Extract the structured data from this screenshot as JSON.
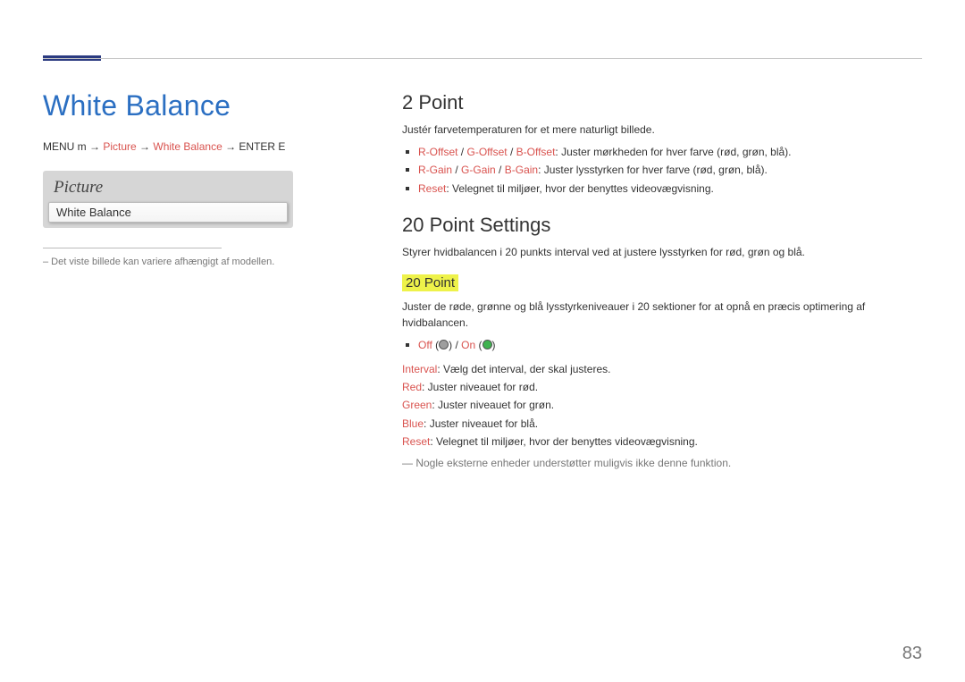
{
  "page_number": "83",
  "left": {
    "h1": "White Balance",
    "menu_path": {
      "prefix": "MENU m → ",
      "picture": "Picture",
      "arrow1": " → ",
      "wb": "White Balance",
      "arrow2": " → ",
      "enter": "ENTER E"
    },
    "picture_box": {
      "title": "Picture",
      "row": "White Balance"
    },
    "small_note": "–  Det viste billede kan variere afhængigt af modellen."
  },
  "right": {
    "s1": {
      "h2": "2 Point",
      "intro": "Justér farvetemperaturen for et mere naturligt billede.",
      "bullets": [
        {
          "r": "R-Offset",
          "sep1": " / ",
          "g": "G-Offset",
          "sep2": " / ",
          "b": "B-Offset",
          "tail": ": Juster mørkheden for hver farve (rød, grøn, blå)."
        },
        {
          "r": "R-Gain",
          "sep1": " / ",
          "g": "G-Gain",
          "sep2": " / ",
          "b": "B-Gain",
          "tail": ": Juster lysstyrken for hver farve (rød, grøn, blå)."
        },
        {
          "r": "Reset",
          "tail": ": Velegnet til miljøer, hvor der benyttes videovægvisning."
        }
      ]
    },
    "s2": {
      "h2": "20 Point Settings",
      "intro": "Styrer hvidbalancen i 20 punkts interval ved at justere lysstyrken for rød, grøn og blå.",
      "h3": "20 Point",
      "desc": "Juster de røde, grønne og blå lysstyrkeniveauer i 20 sektioner for at opnå en præcis optimering af hvidbalancen.",
      "offon": {
        "off": "Off",
        "on": "On"
      },
      "lines": [
        {
          "label": "Interval",
          "text": ": Vælg det interval, der skal justeres."
        },
        {
          "label": "Red",
          "text": ": Juster niveauet for rød."
        },
        {
          "label": "Green",
          "text": ": Juster niveauet for grøn."
        },
        {
          "label": "Blue",
          "text": ": Juster niveauet for blå."
        },
        {
          "label": "Reset",
          "text": ": Velegnet til miljøer, hvor der benyttes videovægvisning."
        }
      ],
      "dash_note": "Nogle eksterne enheder understøtter muligvis ikke denne funktion."
    }
  }
}
